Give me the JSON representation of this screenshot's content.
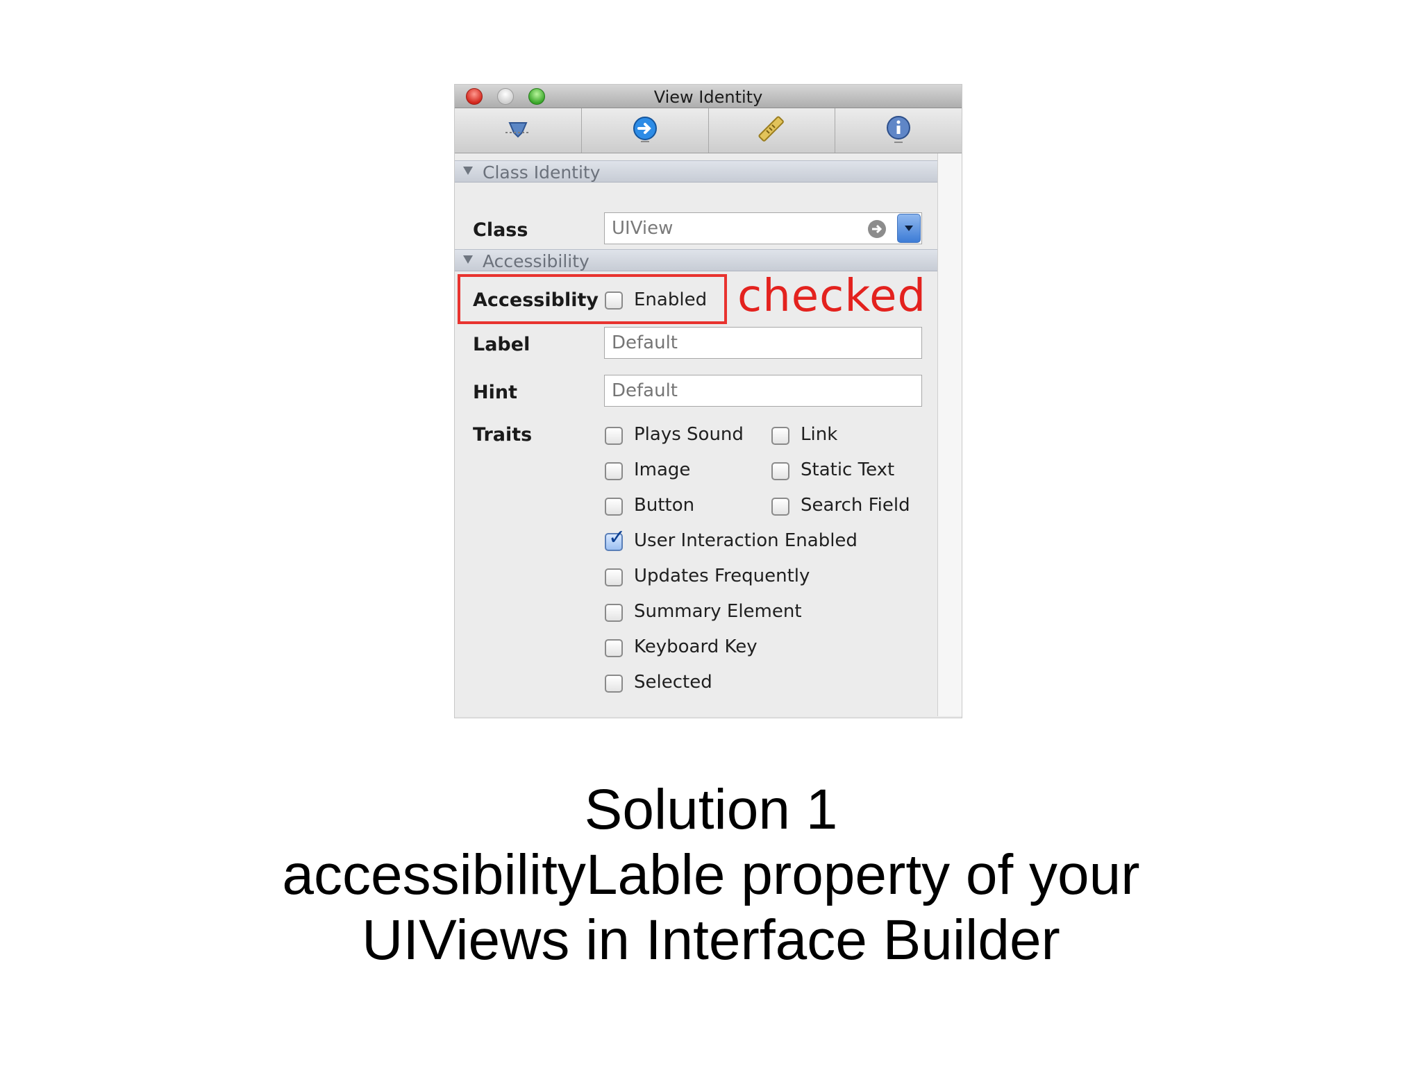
{
  "window": {
    "title": "View Identity"
  },
  "toolbar": {
    "tabs": [
      {
        "icon": "attributes-inspector-icon"
      },
      {
        "icon": "connections-inspector-icon"
      },
      {
        "icon": "size-inspector-ruler-icon"
      },
      {
        "icon": "identity-inspector-info-icon"
      }
    ]
  },
  "class_identity": {
    "header": "Class Identity",
    "class_label": "Class",
    "class_value": "UIView"
  },
  "accessibility": {
    "header": "Accessibility",
    "accessibility_label": "Accessiblity",
    "enabled_label": "Enabled",
    "enabled_checked": false,
    "label_label": "Label",
    "label_placeholder": "Default",
    "hint_label": "Hint",
    "hint_placeholder": "Default",
    "traits_label": "Traits",
    "traits": [
      {
        "label": "Plays Sound",
        "checked": false
      },
      {
        "label": "Link",
        "checked": false
      },
      {
        "label": "Image",
        "checked": false
      },
      {
        "label": "Static Text",
        "checked": false
      },
      {
        "label": "Button",
        "checked": false
      },
      {
        "label": "Search Field",
        "checked": false
      },
      {
        "label": "User Interaction Enabled",
        "checked": true
      },
      {
        "label": "Updates Frequently",
        "checked": false
      },
      {
        "label": "Summary Element",
        "checked": false
      },
      {
        "label": "Keyboard Key",
        "checked": false
      },
      {
        "label": "Selected",
        "checked": false
      }
    ]
  },
  "annotation": {
    "text": "checked",
    "color": "#e3221e"
  },
  "caption": {
    "line1": "Solution 1",
    "line2": "accessibilityLable property of your",
    "line3": "UIViews in Interface Builder"
  }
}
